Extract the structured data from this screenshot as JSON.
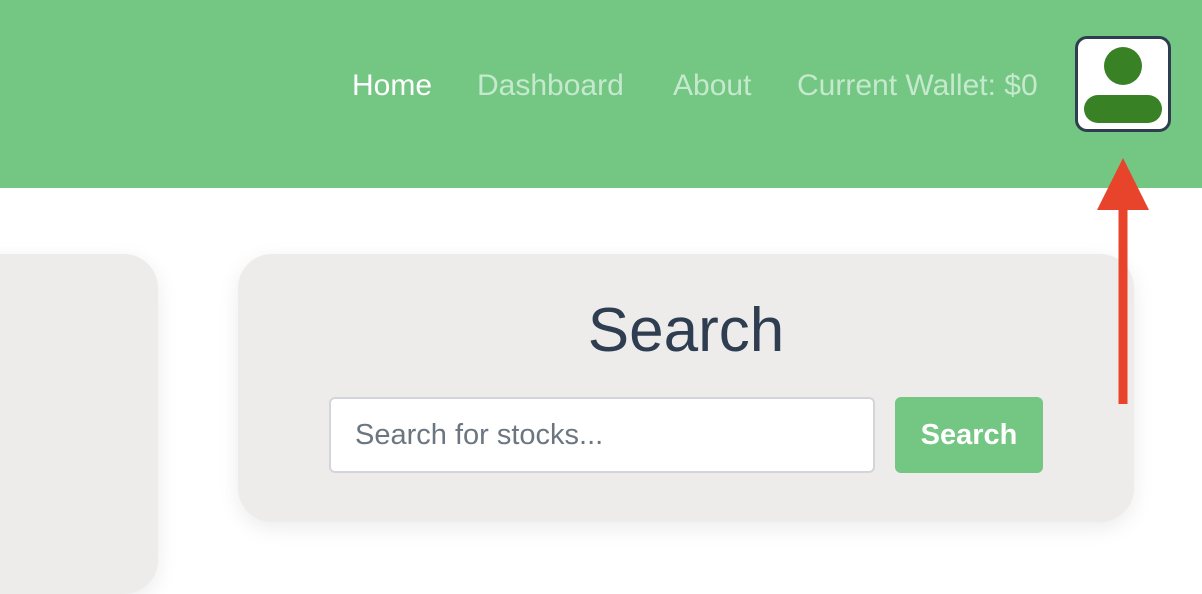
{
  "nav": {
    "links": [
      {
        "label": "Home",
        "active": true
      },
      {
        "label": "Dashboard",
        "active": false
      },
      {
        "label": "About",
        "active": false
      }
    ],
    "wallet_label": "Current Wallet: $0",
    "avatar_icon": "user-icon"
  },
  "search": {
    "title": "Search",
    "placeholder": "Search for stocks...",
    "value": "",
    "button_label": "Search"
  },
  "annotation": {
    "icon": "arrow-up-icon",
    "color": "#e8432b"
  },
  "colors": {
    "brand_green": "#74c683",
    "nav_link_inactive": "#c4e9cd",
    "avatar_green": "#388225",
    "card_background": "#eeeceb",
    "heading_text": "#2e3e50"
  }
}
